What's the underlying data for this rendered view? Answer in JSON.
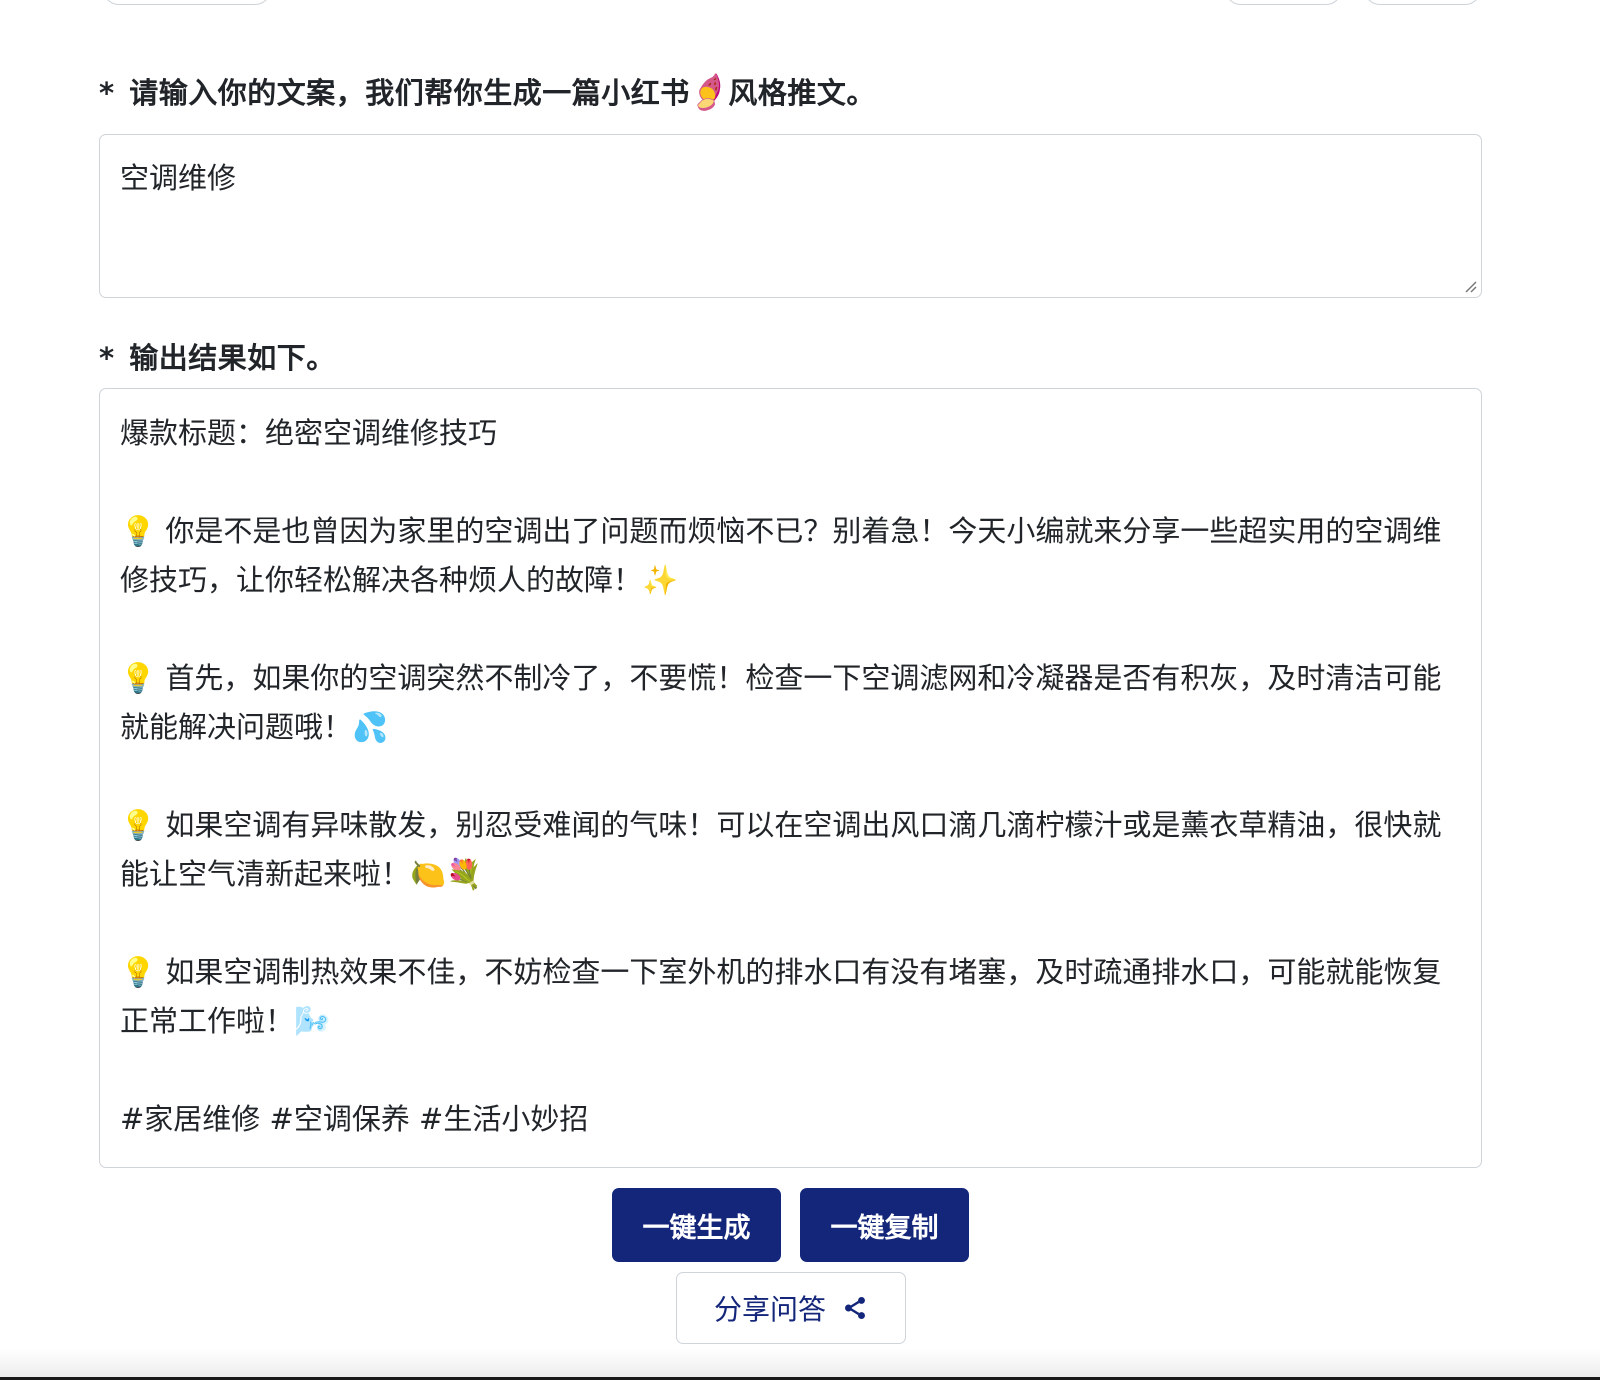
{
  "form": {
    "input_label": {
      "star": "*",
      "text_before": "请输入你的文案，我们帮你生成一篇小红书",
      "emoji": "🍠",
      "text_after": "风格推文。"
    },
    "input_value": "空调维修",
    "output_label": {
      "star": "*",
      "text": "输出结果如下。"
    },
    "output": {
      "title_line": "爆款标题：绝密空调维修技巧",
      "paragraphs": [
        "💡 你是不是也曾因为家里的空调出了问题而烦恼不已？别着急！今天小编就来分享一些超实用的空调维修技巧，让你轻松解决各种烦人的故障！✨",
        "💡 首先，如果你的空调突然不制冷了，不要慌！检查一下空调滤网和冷凝器是否有积灰，及时清洁可能就能解决问题哦！💦",
        "💡 如果空调有异味散发，别忍受难闻的气味！可以在空调出风口滴几滴柠檬汁或是薰衣草精油，很快就能让空气清新起来啦！🍋💐",
        "💡 如果空调制热效果不佳，不妨检查一下室外机的排水口有没有堵塞，及时疏通排水口，可能就能恢复正常工作啦！🌬️"
      ],
      "tags_line": "#家居维修 #空调保养 #生活小妙招"
    }
  },
  "buttons": {
    "generate_label": "一键生成",
    "copy_label": "一键复制",
    "share_label": "分享问答",
    "share_icon": "share-icon"
  },
  "colors": {
    "primary": "#14267a",
    "border": "#ced4da",
    "text": "#212529"
  }
}
